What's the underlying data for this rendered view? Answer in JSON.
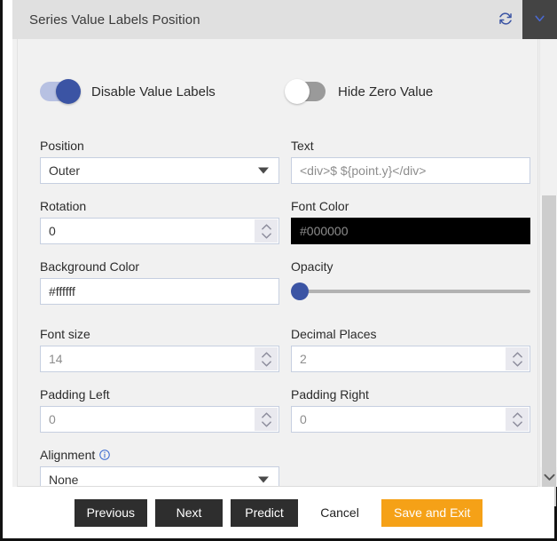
{
  "dialog": {
    "title": "Series Value Labels Position",
    "refresh_icon": "refresh-icon",
    "collapse_icon": "chevron-down-icon"
  },
  "toggles": [
    {
      "label": "Disable Value Labels",
      "state": "on"
    },
    {
      "label": "Hide Zero Value",
      "state": "off"
    }
  ],
  "fields": {
    "position": {
      "label": "Position",
      "value": "Outer"
    },
    "text": {
      "label": "Text",
      "value": "<div>$ ${point.y}</div>"
    },
    "rotation": {
      "label": "Rotation",
      "value": "0"
    },
    "font_color": {
      "label": "Font Color",
      "value": "#000000",
      "swatch": "#000000"
    },
    "background_color": {
      "label": "Background Color",
      "value": "#ffffff",
      "swatch": "#ffffff"
    },
    "opacity": {
      "label": "Opacity",
      "value": "0"
    },
    "font_size": {
      "label": "Font size",
      "value": "14"
    },
    "decimal_places": {
      "label": "Decimal Places",
      "value": "2"
    },
    "padding_left": {
      "label": "Padding Left",
      "value": "0"
    },
    "padding_right": {
      "label": "Padding Right",
      "value": "0"
    },
    "alignment": {
      "label": "Alignment",
      "value": "None",
      "info_icon": "info-icon"
    }
  },
  "footer": {
    "previous": "Previous",
    "next": "Next",
    "predict": "Predict",
    "cancel": "Cancel",
    "save_and_exit": "Save and Exit"
  },
  "colors": {
    "accent_blue": "#3b54a4",
    "accent_orange": "#f5a117",
    "titlebar": "#e0e0e0",
    "panel": "#f1f1f1",
    "dark_button": "#2e2e2e"
  },
  "scrollbar": {
    "down_icon": "chevron-down-icon"
  }
}
